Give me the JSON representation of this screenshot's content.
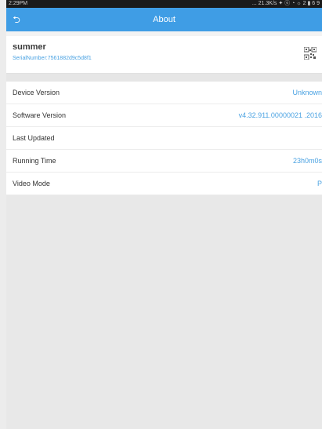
{
  "status_bar": {
    "time": "2:29PM",
    "right_text": "... 21.3K/s ✦ ⓔ ◔ ☼ 2 ▮ 6 9"
  },
  "app_bar": {
    "title": "About"
  },
  "device": {
    "name": "summer",
    "serial_label": "SerialNumber:7561882d9c5d8f1",
    "qr_icon": "qr-code-icon"
  },
  "info": [
    {
      "label": "Device Version",
      "value": "Unknown"
    },
    {
      "label": "Software Version",
      "value": "v4.32.911.00000021  .2016"
    },
    {
      "label": "Last Updated",
      "value": ""
    },
    {
      "label": "Running Time",
      "value": "23h0m0s"
    },
    {
      "label": "Video Mode",
      "value": "P"
    }
  ],
  "colors": {
    "app_bar": "#3f9de5",
    "accent": "#4aa2e2",
    "background": "#e8e8e8"
  }
}
